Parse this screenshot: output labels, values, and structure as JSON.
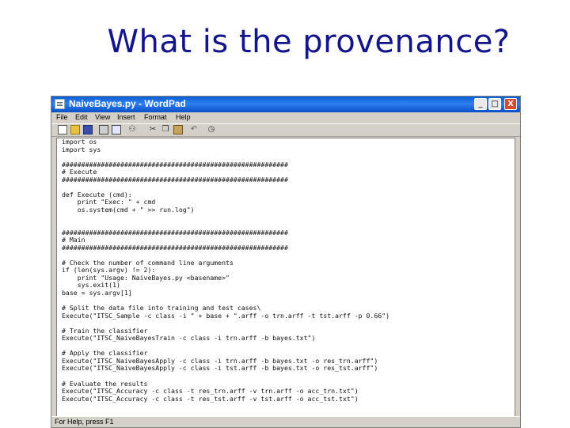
{
  "slide": {
    "title": "What is the provenance?"
  },
  "window": {
    "title": "NaiveBayes.py - WordPad",
    "controls": {
      "minimize": "_",
      "maximize": "□",
      "close": "X"
    }
  },
  "menu": [
    "File",
    "Edit",
    "View",
    "Insert",
    "Format",
    "Help"
  ],
  "toolbar": [
    "new-icon",
    "open-icon",
    "save-icon",
    "print-icon",
    "print-preview-icon",
    "find-icon",
    "cut-icon",
    "copy-icon",
    "paste-icon",
    "undo-icon",
    "date-time-icon"
  ],
  "code_lines": [
    "import os",
    "import sys",
    "",
    "##########################################################",
    "# Execute",
    "##########################################################",
    "",
    "def Execute (cmd):",
    "    print \"Exec: \" + cmd",
    "    os.system(cmd + \" >> run.log\")",
    "",
    "",
    "##########################################################",
    "# Main",
    "##########################################################",
    "",
    "# Check the number of command line arguments",
    "if (len(sys.argv) != 2):",
    "    print \"Usage: NaiveBayes.py <basename>\"",
    "    sys.exit(1)",
    "base = sys.argv[1]",
    "",
    "# Split the data file into training and test cases\\",
    "Execute(\"ITSC_Sample -c class -i \" + base + \".arff -o trn.arff -t tst.arff -p 0.66\")",
    "",
    "# Train the classifier",
    "Execute(\"ITSC_NaiveBayesTrain -c class -i trn.arff -b bayes.txt\")",
    "",
    "# Apply the classifier",
    "Execute(\"ITSC_NaiveBayesApply -c class -i trn.arff -b bayes.txt -o res_trn.arff\")",
    "Execute(\"ITSC_NaiveBayesApply -c class -i tst.arff -b bayes.txt -o res_tst.arff\")",
    "",
    "# Evaluate the results",
    "Execute(\"ITSC_Accuracy -c class -t res_trn.arff -v trn.arff -o acc_trn.txt\")",
    "Execute(\"ITSC_Accuracy -c class -t res_tst.arff -v tst.arff -o acc_tst.txt\")"
  ],
  "status": {
    "text": "For Help, press F1"
  }
}
